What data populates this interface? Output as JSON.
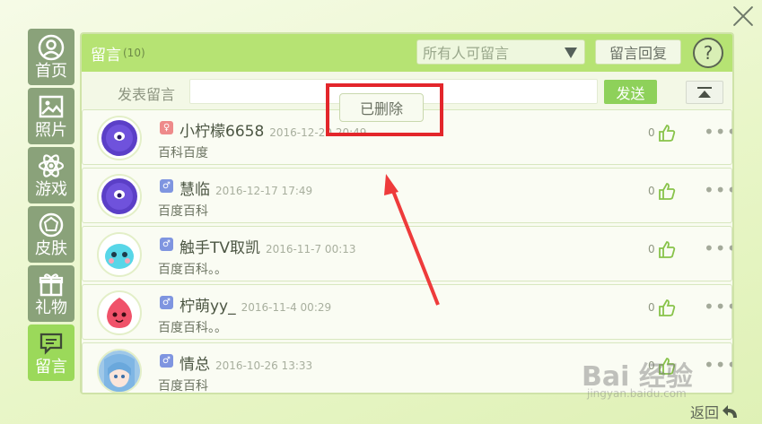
{
  "sidebar": {
    "items": [
      {
        "label": "首页",
        "icon": "home-icon"
      },
      {
        "label": "照片",
        "icon": "photo-icon"
      },
      {
        "label": "游戏",
        "icon": "game-icon"
      },
      {
        "label": "皮肤",
        "icon": "skin-icon"
      },
      {
        "label": "礼物",
        "icon": "gift-icon"
      },
      {
        "label": "留言",
        "icon": "message-icon"
      }
    ],
    "active": "留言"
  },
  "header": {
    "title": "留言",
    "count": "(10)",
    "permission_select": "所有人可留言",
    "reply_button": "留言回复",
    "help_label": "?"
  },
  "post": {
    "label": "发表留言",
    "input_value": "",
    "send_button": "发送"
  },
  "messages": [
    {
      "name": "小柠檬6658",
      "time": "2016-12-20 20:49",
      "text": "百科百度",
      "likes": "0",
      "gender": "female"
    },
    {
      "name": "慧临",
      "time": "2016-12-17  17:49",
      "text": "百度百科",
      "likes": "0",
      "gender": "male"
    },
    {
      "name": "触手TV取凯",
      "time": "2016-11-7  00:13",
      "text": "百度百科。。",
      "likes": "0",
      "gender": "male"
    },
    {
      "name": "柠萌yy_",
      "time": "2016-11-4  00:29",
      "text": "百度百科。。",
      "likes": "0",
      "gender": "male"
    },
    {
      "name": "情总",
      "time": "2016-10-26  13:33",
      "text": "百度百科",
      "likes": "0",
      "gender": "male"
    }
  ],
  "popup": {
    "text": "已删除"
  },
  "footer": {
    "back": "返回"
  },
  "watermark": {
    "text": "Bai 经验",
    "sub": "jingyan.baidu.com"
  },
  "colors": {
    "accent": "#b6e373",
    "active_tab": "#9bd95a",
    "annotation": "#e3262b"
  }
}
